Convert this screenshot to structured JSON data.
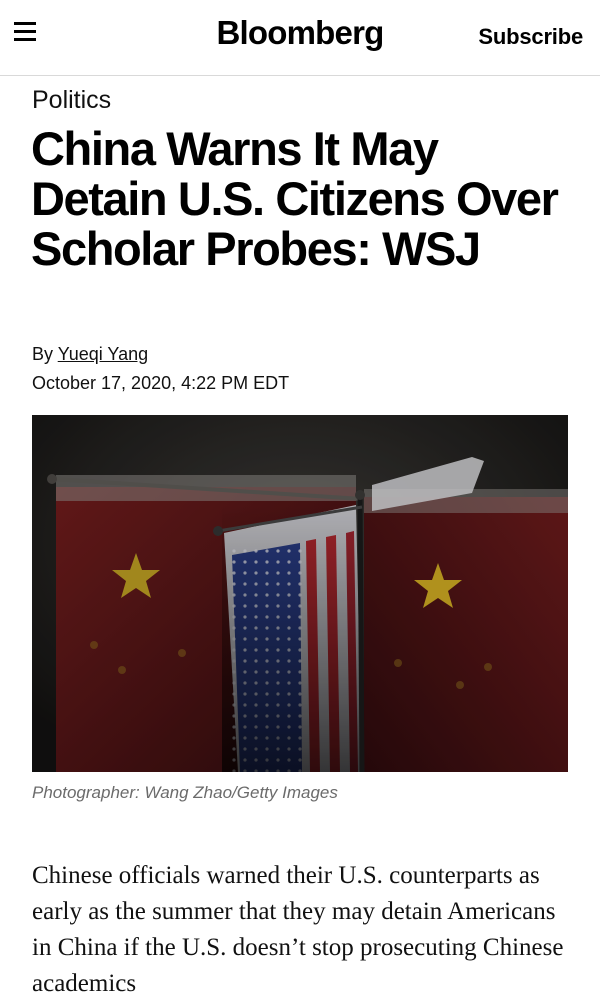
{
  "header": {
    "menu_icon": "hamburger-menu-icon",
    "brand": "Bloomberg",
    "subscribe_label": "Subscribe"
  },
  "article": {
    "category": "Politics",
    "headline": "China Warns It May Detain U.S. Citizens Over Scholar Probes: WSJ",
    "byline_prefix": "By",
    "author": "Yueqi Yang",
    "date": "October 17, 2020, 4:22 PM EDT",
    "photo_caption": "Photographer: Wang Zhao/Getty Images",
    "body": "Chinese officials warned their U.S. counterparts as early as the summer that they may detain Americans in China if the U.S. doesn’t stop prosecuting Chinese academics"
  },
  "colors": {
    "divider": "#d9d9d9",
    "caption": "#6b6b6b",
    "text": "#111111"
  }
}
